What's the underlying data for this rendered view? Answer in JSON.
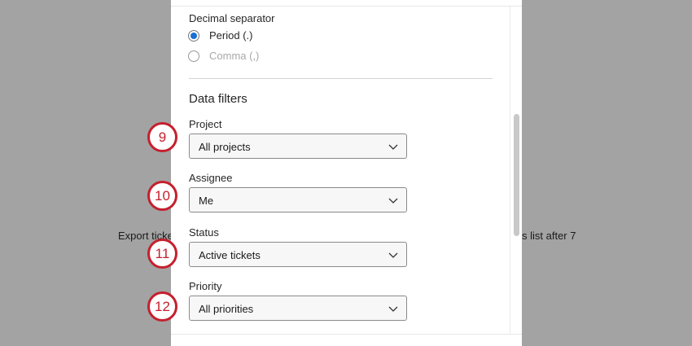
{
  "background": {
    "text_left": "Export ticke",
    "text_right": "s list after 7"
  },
  "decimal_separator": {
    "label": "Decimal separator",
    "options": [
      {
        "label": "Period (.)",
        "selected": true,
        "disabled": false
      },
      {
        "label": "Comma (,)",
        "selected": false,
        "disabled": true
      }
    ]
  },
  "data_filters": {
    "title": "Data filters",
    "fields": [
      {
        "label": "Project",
        "value": "All projects",
        "badge": "9"
      },
      {
        "label": "Assignee",
        "value": "Me",
        "badge": "10"
      },
      {
        "label": "Status",
        "value": "Active tickets",
        "badge": "11"
      },
      {
        "label": "Priority",
        "value": "All priorities",
        "badge": "12"
      }
    ]
  },
  "colors": {
    "accent": "#1a6fd6",
    "badge": "#c4202e"
  }
}
